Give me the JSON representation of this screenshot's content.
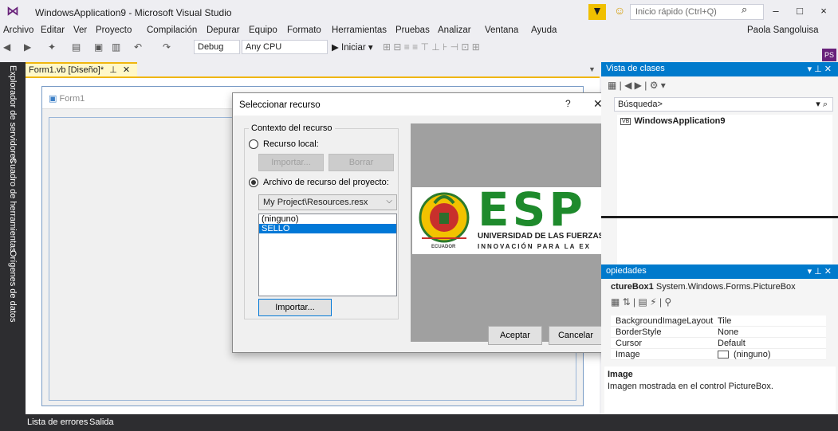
{
  "window": {
    "title": "WindowsApplication9 - Microsoft Visual Studio",
    "quick_launch_placeholder": "Inicio rápido (Ctrl+Q)",
    "minimize": "‒",
    "maximize": "□",
    "close": "×"
  },
  "menu": {
    "items": [
      "Archivo",
      "Editar",
      "Ver",
      "Proyecto",
      "Compilación",
      "Depurar",
      "Equipo",
      "Formato",
      "Herramientas",
      "Pruebas",
      "Analizar",
      "Ventana",
      "Ayuda"
    ],
    "user": "Paola Sangoluisa",
    "user_initials": "PS"
  },
  "toolbar": {
    "config": "Debug",
    "platform": "Any CPU",
    "run": "▶ Iniciar ▾"
  },
  "left_tabs": [
    "Explorador de servidores",
    "Cuadro de herramientas",
    "Orígenes de datos"
  ],
  "document": {
    "tab_label": "Form1.vb [Diseño]*",
    "form_title": "Form1"
  },
  "dialog": {
    "title": "Seleccionar recurso",
    "help": "?",
    "close": "✕",
    "group_label": "Contexto del recurso",
    "local_label": "Recurso local:",
    "import_disabled": "Importar...",
    "delete_disabled": "Borrar",
    "project_label": "Archivo de recurso del proyecto:",
    "resource_file": "My Project\\Resources.resx",
    "list_items": [
      "(ninguno)",
      "SELLO"
    ],
    "selected_item": "SELLO",
    "import_button": "Importar...",
    "accept_button": "Aceptar",
    "cancel_button": "Cancelar",
    "logo_big": "ESP",
    "logo_line1": "UNIVERSIDAD DE LAS FUERZAS",
    "logo_line2": "INNOVACIÓN PARA LA EX",
    "logo_small": "ECUADOR"
  },
  "class_view": {
    "title": "Vista de clases",
    "search_placeholder": "Búsqueda>",
    "root_badge": "VB",
    "root_item": "WindowsApplication9"
  },
  "properties": {
    "title": "opiedades",
    "object_name": "ctureBox1",
    "object_type": "System.Windows.Forms.PictureBox",
    "rows": [
      {
        "name": "BackgroundImageLayout",
        "value": "Tile"
      },
      {
        "name": "BorderStyle",
        "value": "None"
      },
      {
        "name": "Cursor",
        "value": "Default"
      },
      {
        "name": "Image",
        "value": "(ninguno)"
      }
    ],
    "desc_title": "Image",
    "desc_text": "Imagen mostrada en el control PictureBox."
  },
  "status": {
    "items": [
      "Lista de errores",
      "Salida"
    ]
  },
  "colors": {
    "accent": "#007acc",
    "brand": "#68217a",
    "selection": "#0078d7",
    "doc_tab": "#efb610"
  }
}
